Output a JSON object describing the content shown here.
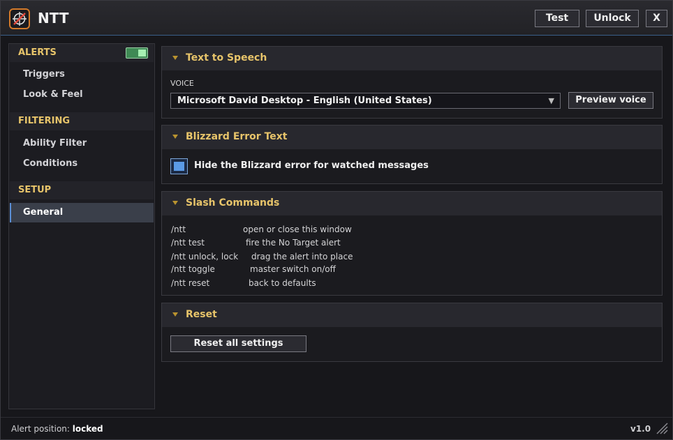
{
  "app": {
    "title": "NTT",
    "version": "v1.0"
  },
  "titlebar": {
    "buttons": [
      {
        "label": "Test"
      },
      {
        "label": "Unlock"
      },
      {
        "label": "X"
      }
    ]
  },
  "sidebar": {
    "sections": [
      {
        "header": "ALERTS",
        "items": [
          "Triggers",
          "Look & Feel"
        ],
        "toggle_on": true
      },
      {
        "header": "FILTERING",
        "items": [
          "Ability Filter",
          "Conditions"
        ]
      },
      {
        "header": "SETUP",
        "items": [
          "General"
        ]
      }
    ],
    "active_item": "General"
  },
  "panels": {
    "tts": {
      "title": "Text to Speech",
      "voice_label": "VOICE",
      "voice_value": "Microsoft David Desktop - English (United States)",
      "preview_label": "Preview voice"
    },
    "blizzard": {
      "title": "Blizzard Error Text",
      "checkbox_label": "Hide the Blizzard error for watched messages",
      "checked": true
    },
    "slash": {
      "title": "Slash Commands",
      "commands": [
        {
          "cmd": "/ntt",
          "desc": "open or close this window"
        },
        {
          "cmd": "/ntt test",
          "desc": "fire the No Target alert"
        },
        {
          "cmd": "/ntt unlock, lock",
          "desc": "drag the alert into place"
        },
        {
          "cmd": "/ntt toggle",
          "desc": "master switch on/off"
        },
        {
          "cmd": "/ntt reset",
          "desc": "back to defaults"
        }
      ]
    },
    "reset": {
      "title": "Reset",
      "button_label": "Reset all settings"
    }
  },
  "status": {
    "label": "Alert position:",
    "value": "locked"
  },
  "colors": {
    "accent_gold": "#e7c46a",
    "accent_blue": "#3a5f8a",
    "toggle_green": "#3f8a55",
    "checkbox_blue": "#5b9be6",
    "logo_orange": "#d47a2a"
  },
  "icons": {
    "logo": "no-target-crosshair-icon",
    "collapse": "caret-down-icon",
    "dropdown": "dropdown-arrow-icon",
    "resize": "resize-grip-icon"
  }
}
